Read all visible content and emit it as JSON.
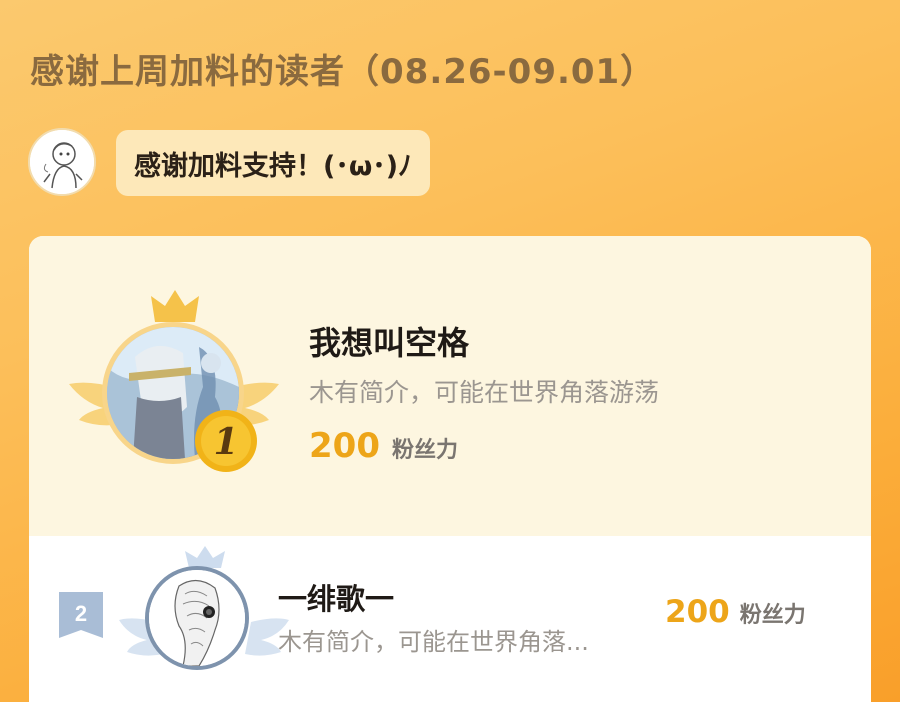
{
  "header": {
    "title": "感谢上周加料的读者（08.26-09.01）"
  },
  "author": {
    "avatar_icon": "author-sketch-avatar",
    "message": "感谢加料支持！(･ω･)ﾉ"
  },
  "colors": {
    "background": "#fbbd55",
    "accent_gold": "#eda519",
    "rank2_blue": "#7e93ad"
  },
  "readers": [
    {
      "rank": "1",
      "name": "我想叫空格",
      "description": "木有简介，可能在世界角落游荡",
      "fans": "200",
      "fans_unit": "粉丝力",
      "badge": "gold-crown-wings"
    },
    {
      "rank": "2",
      "name": "一绯歌一",
      "description": "木有简介，可能在世界角落...",
      "fans": "200",
      "fans_unit": "粉丝力",
      "badge": "silver-crown-wings"
    }
  ]
}
